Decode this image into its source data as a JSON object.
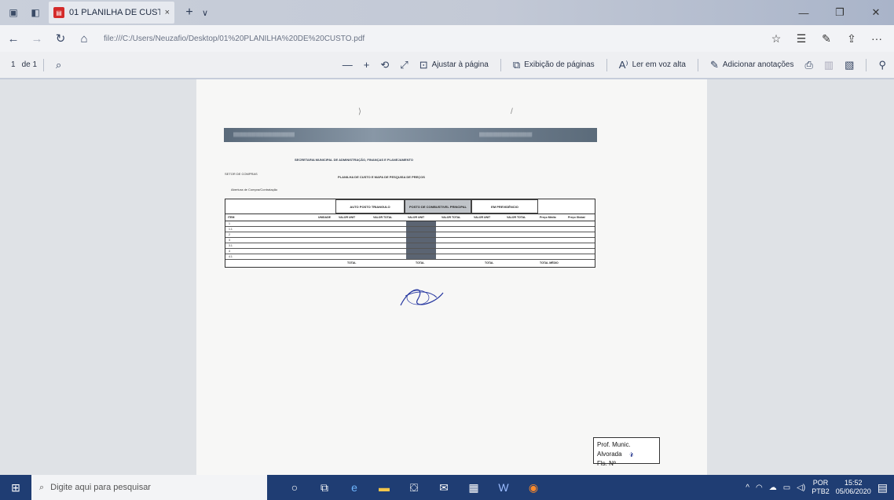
{
  "browser": {
    "tab_title": "01 PLANILHA DE CUSTC",
    "tab_close": "×",
    "new_tab": "+",
    "tab_menu": "∨",
    "url": "file:///C:/Users/Neuzafio/Desktop/01%20PLANILHA%20DE%20CUSTO.pdf"
  },
  "pdf_toolbar": {
    "page_current": "1",
    "page_of": "de 1",
    "zoom_out": "—",
    "zoom_in": "+",
    "fit_page": "Ajustar à página",
    "page_view": "Exibição de páginas",
    "read_aloud": "Ler em voz alta",
    "add_notes": "Adicionar anotações"
  },
  "document": {
    "secretaria": "SECRETARIA MUNICIPAL DE ADMINISTRAÇÃO, FINANÇAS E PLANEJAMENTO",
    "setor": "SETOR DE COMPRAS",
    "planilha_title": "PLANILHA DE CUSTO E MAPA DE PESQUISA DE PREÇOS",
    "aviso": "Abertura de Compra/Contratação",
    "groups": [
      "AUTO POSTO TRIANGULO",
      "POSTO DE COMBUSTIVEL PRINCIPAL",
      "EM PREVIDÊNCIO"
    ],
    "columns": [
      "ITEM",
      "UNIDADE",
      "VALOR UNIT",
      "VALOR TOTAL",
      "VALOR UNIT",
      "VALOR TOTAL",
      "VALOR UNIT",
      "VALOR TOTAL",
      "Preço Médio",
      "Preço Global"
    ],
    "rows": [
      {
        "item": "1"
      },
      {
        "item": "1.1"
      },
      {
        "item": "2"
      },
      {
        "item": "3"
      },
      {
        "item": "3.1"
      },
      {
        "item": "4"
      },
      {
        "item": "4.1"
      }
    ],
    "total_label": "TOTAL",
    "total_medio_label": "TOTAL MÉDIO",
    "stamp_line1": "Prof. Munic. Alvorada",
    "stamp_line2": "Fls. Nº"
  },
  "taskbar": {
    "search_placeholder": "Digite aqui para pesquisar",
    "lang_top": "POR",
    "lang_bottom": "PTB2",
    "time": "15:52",
    "date": "05/06/2020"
  }
}
